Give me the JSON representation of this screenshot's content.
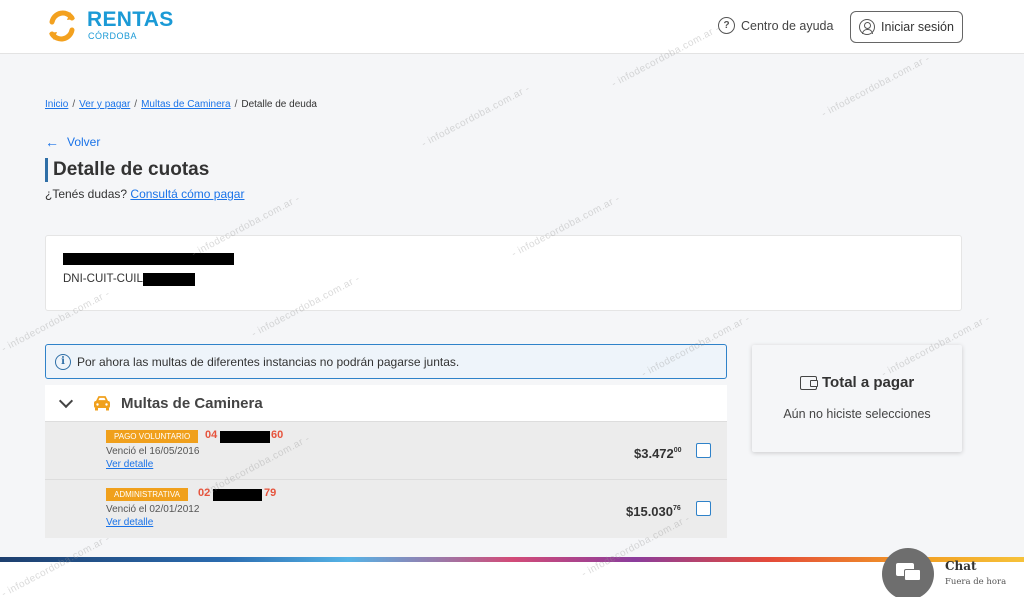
{
  "header": {
    "logo_title": "RENTAS",
    "logo_subtitle": "CÓRDOBA",
    "help_label": "Centro de ayuda",
    "help_glyph": "?",
    "login_label": "Iniciar sesión"
  },
  "breadcrumb": {
    "items": [
      "Inicio",
      "Ver y pagar",
      "Multas de Caminera"
    ],
    "current": "Detalle de deuda"
  },
  "back_label": "Volver",
  "page_title": "Detalle de cuotas",
  "doubt": {
    "question": "¿Tenés dudas?",
    "link": "Consultá cómo pagar"
  },
  "taxpayer": {
    "dni_label": "DNI-CUIT-CUIL:"
  },
  "notice": {
    "glyph": "i",
    "text": "Por ahora las multas de diferentes instancias no podrán pagarse juntas."
  },
  "group": {
    "title": "Multas de Caminera"
  },
  "fines": [
    {
      "badge": "PAGO VOLUNTARIO",
      "code_prefix": "04",
      "code_suffix": "60",
      "due": "Venció el 16/05/2016",
      "link": "Ver detalle",
      "amount_main": "$3.472",
      "amount_cents": "00"
    },
    {
      "badge": "ADMINISTRATIVA",
      "code_prefix": "02",
      "code_suffix": "79",
      "due": "Venció el 02/01/2012",
      "link": "Ver detalle",
      "amount_main": "$15.030",
      "amount_cents": "76"
    }
  ],
  "total": {
    "title": "Total a pagar",
    "empty_text": "Aún no hiciste selecciones"
  },
  "chat": {
    "label": "Chat",
    "status": "Fuera de hora"
  },
  "watermark": "- infodecordoba.com.ar -",
  "colors": {
    "brand_blue": "#1b9ad6",
    "brand_orange": "#f0a01c",
    "link": "#1a73e8",
    "code_red": "#e6543d"
  }
}
